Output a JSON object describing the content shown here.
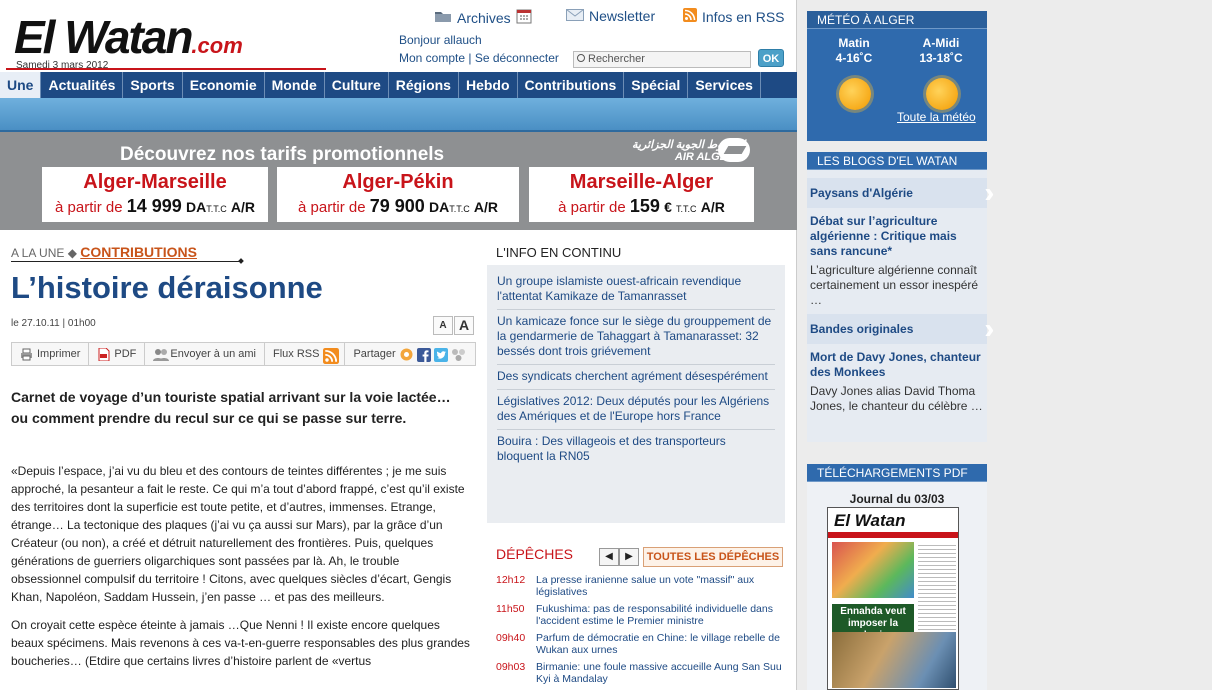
{
  "header": {
    "logo_main": "El Watan",
    "logo_suffix": ".com",
    "date": "Samedi 3 mars 2012",
    "archives": "Archives",
    "newsletter": "Newsletter",
    "rss": "Infos en RSS",
    "welcome": "Bonjour allauch",
    "account": "Mon compte | Se déconnecter",
    "search_placeholder": "Rechercher",
    "ok_label": "OK"
  },
  "menu": [
    "Une",
    "Actualités",
    "Sports",
    "Economie",
    "Monde",
    "Culture",
    "Régions",
    "Hebdo",
    "Contributions",
    "Spécial",
    "Services"
  ],
  "banner": {
    "title": "Découvrez nos tarifs promotionnels",
    "airline_ar": "الخطوط الجوية الجزائرية",
    "airline": "AIR ALGERIE",
    "offers": [
      {
        "route": "Alger-Marseille",
        "prefix": "à partir de",
        "amount": "14 999",
        "currency": "DA",
        "ttc": "T.T.C",
        "ar": "A/R"
      },
      {
        "route": "Alger-Pékin",
        "prefix": "à partir de",
        "amount": "79 900",
        "currency": "DA",
        "ttc": "T.T.C",
        "ar": "A/R"
      },
      {
        "route": "Marseille-Alger",
        "prefix": "à partir de",
        "amount": "159",
        "currency": "€",
        "ttc": "T.T.C",
        "ar": "A/R"
      }
    ]
  },
  "article": {
    "crumb_prefix": "A LA UNE",
    "crumb_section": "CONTRIBUTIONS",
    "title": "L’histoire déraisonne",
    "date": "le 27.10.11 | 01h00",
    "font_small": "A",
    "font_large": "A",
    "tools": {
      "print": "Imprimer",
      "pdf": "PDF",
      "send": "Envoyer à un ami",
      "rss": "Flux RSS",
      "share": "Partager"
    },
    "lead": "Carnet de voyage d’un touriste spatial arrivant sur la voie lactée… ou comment prendre du recul sur ce qui se passe sur terre.",
    "para1": "«Depuis l’espace, j’ai vu du bleu et des contours de teintes différentes ; je me suis approché, la pesanteur a fait le reste. Ce qui m’a tout d’abord frappé, c’est qu’il existe des territoires dont la superficie est toute petite, et d’autres, immenses. Etrange, étrange…  La tectonique des plaques (j’ai vu ça aussi sur Mars), par la grâce d’un Créateur (ou non), a créé et détruit naturellement des frontières. Puis, quelques générations de guerriers oligarchiques sont passées par là. Ah, le trouble obsessionnel compulsif du territoire ! Citons, avec quelques siècles d’écart, Gengis Khan, Napoléon, Saddam Hussein, j’en passe … et pas des meilleurs.",
    "para2": "On croyait cette espèce éteinte à jamais …Que Nenni ! Il existe encore quelques beaux spécimens. Mais revenons à ces va-t-en-guerre responsables des plus grandes boucheries… (Etdire que certains livres d’histoire parlent de «vertus"
  },
  "info_continu": {
    "heading": "L'INFO EN CONTINU",
    "items": [
      "Un groupe islamiste ouest-africain revendique l'attentat Kamikaze de Tamanrasset",
      "Un kamicaze fonce sur le siège du grouppement de la gendarmerie de Tahaggart à Tamanarasset: 32 bessés dont trois griévement",
      "Des syndicats cherchent agrément désespérément",
      "Législatives 2012: Deux députés pour les Algériens des Amériques et de l'Europe hors France",
      "Bouira : Des villageois et des transporteurs bloquent la RN05"
    ]
  },
  "depeches": {
    "heading": "DÉPÊCHES",
    "prev": "◀",
    "next": "▶",
    "all_label": "TOUTES LES DÉPÊCHES",
    "items": [
      {
        "time": "12h12",
        "text": "La presse iranienne salue un vote \"massif\" aux législatives"
      },
      {
        "time": "11h50",
        "text": "Fukushima: pas de responsabilité individuelle dans l'accident estime le Premier ministre"
      },
      {
        "time": "09h40",
        "text": "Parfum de démocratie en Chine: le village rebelle de Wukan aux urnes"
      },
      {
        "time": "09h03",
        "text": "Birmanie: une foule massive accueille Aung San Suu Kyi à Mandalay"
      }
    ]
  },
  "meteo": {
    "heading": "MÉTÉO À ALGER",
    "morning_label": "Matin",
    "morning_temp": "4-16˚C",
    "afternoon_label": "A-Midi",
    "afternoon_temp": "13-18˚C",
    "link": "Toute la météo"
  },
  "blogs": {
    "heading": "LES BLOGS D'EL WATAN",
    "entries": [
      {
        "blog": "Paysans d'Algérie",
        "title": "Débat sur l’agriculture algérienne : Critique mais sans rancune*",
        "text": "L’agriculture algérienne connaît certainement un essor inespéré …"
      },
      {
        "blog": "Bandes originales",
        "title": "Mort de Davy Jones, chanteur des Monkees",
        "text": "Davy Jones alias David Thoma Jones, le chanteur du célèbre …"
      }
    ]
  },
  "pdf": {
    "heading": "TÉLÉCHARGEMENTS PDF",
    "journal": "Journal du 03/03",
    "paper_name": "El Watan",
    "paper_headline": "Ennahda veut imposer la charia"
  }
}
